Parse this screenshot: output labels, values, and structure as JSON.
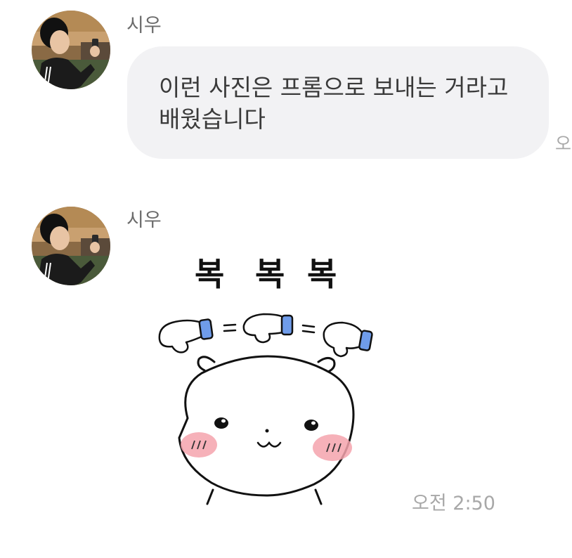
{
  "colors": {
    "bubble_bg": "#f2f2f4",
    "sender_text": "#6b6b6b",
    "message_text": "#3a3a3a",
    "timestamp_text": "#a8a8a8",
    "cuff_blue": "#6f9cea",
    "blush_pink": "#f4a3ad"
  },
  "messages": [
    {
      "sender": "시우",
      "avatar_icon": "profile-photo-avatar",
      "lines": [
        "이런 사진은 프롬으로 보내는 거라고",
        "배웠습니다"
      ],
      "time_partial": "오"
    },
    {
      "sender": "시우",
      "avatar_icon": "profile-photo-avatar",
      "sticker": {
        "icon": "patting-bunny-sticker",
        "texts": [
          "복",
          "복",
          "복"
        ]
      },
      "time": "오전 2:50"
    }
  ]
}
